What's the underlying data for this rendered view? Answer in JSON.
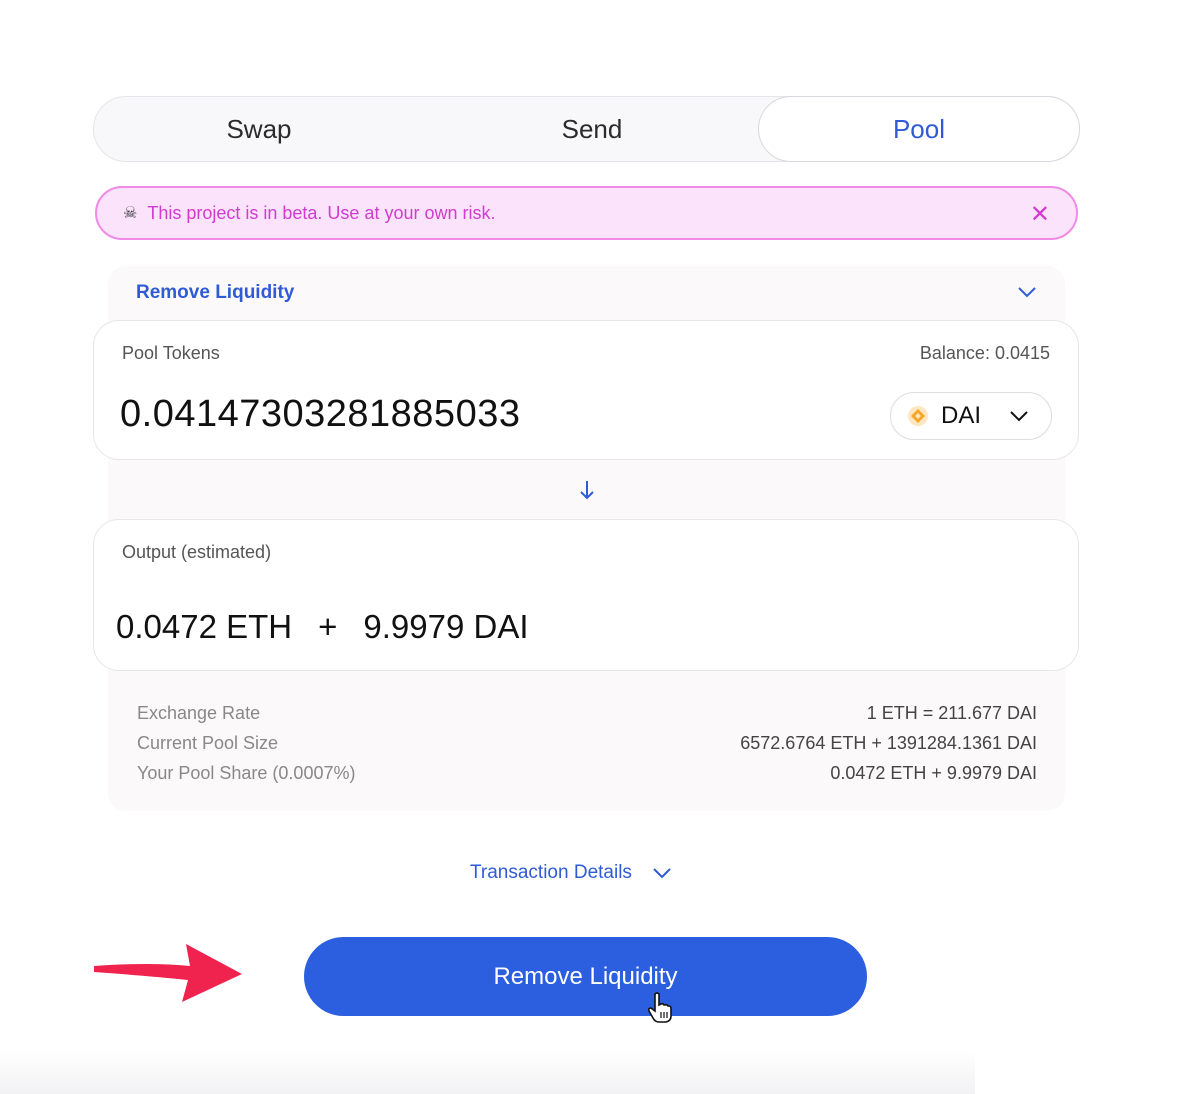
{
  "tabs": [
    {
      "label": "Swap",
      "active": false
    },
    {
      "label": "Send",
      "active": false
    },
    {
      "label": "Pool",
      "active": true
    }
  ],
  "banner": {
    "icon": "skull-icon",
    "message": "This project is in beta. Use at your own risk.",
    "close_glyph": "✕"
  },
  "mode": {
    "label": "Remove Liquidity"
  },
  "pool_tokens": {
    "label": "Pool Tokens",
    "balance": "Balance: 0.0415",
    "amount": "0.04147303281885033",
    "token": "DAI"
  },
  "output": {
    "label": "Output (estimated)",
    "eth": "0.0472 ETH",
    "plus": "+",
    "dai": "9.9979 DAI"
  },
  "info": [
    {
      "key": "Exchange Rate",
      "value": "1 ETH = 211.677 DAI"
    },
    {
      "key": "Current Pool Size",
      "value": "6572.6764 ETH + 1391284.1361 DAI"
    },
    {
      "key": "Your Pool Share (0.0007%)",
      "value": "0.0472 ETH + 9.9979 DAI"
    }
  ],
  "transaction_details": {
    "label": "Transaction Details"
  },
  "remove_button": {
    "label": "Remove Liquidity"
  },
  "colors": {
    "accent": "#2f5bd6",
    "button": "#2b5fe0",
    "banner_bg": "#fbe3fb",
    "banner_text": "#d13bd0",
    "annotation_arrow": "#f0234f",
    "dai_icon": "#f5a623"
  }
}
